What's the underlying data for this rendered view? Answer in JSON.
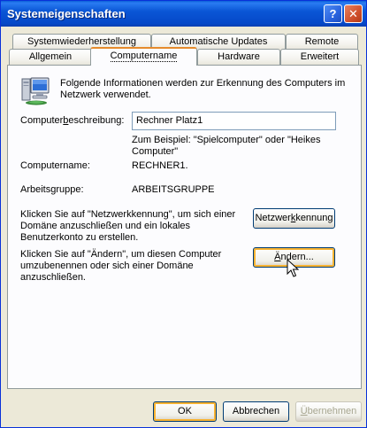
{
  "window": {
    "title": "Systemeigenschaften",
    "help_glyph": "?",
    "close_glyph": "✕"
  },
  "tabs": {
    "row_back": [
      "Systemwiederherstellung",
      "Automatische Updates",
      "Remote"
    ],
    "row_front": [
      "Allgemein",
      "Computername",
      "Hardware",
      "Erweitert"
    ],
    "active": "Computername"
  },
  "panel": {
    "intro_text": "Folgende Informationen werden zur Erkennung des Computers im Netzwerk verwendet.",
    "description": {
      "label_pre": "Computer",
      "label_underlined": "b",
      "label_post": "eschreibung:",
      "value": "Rechner Platz1",
      "hint": "Zum Beispiel: \"Spielcomputer\" oder \"Heikes Computer\""
    },
    "full_name": {
      "label": "Computername:",
      "value": "RECHNER1."
    },
    "workgroup": {
      "label": "Arbeitsgruppe:",
      "value": "ARBEITSGRUPPE"
    },
    "network_id": {
      "text": "Klicken Sie auf \"Netzwerkkennung\", um sich einer Domäne anzuschließen und ein lokales Benutzerkonto zu erstellen.",
      "button_pre": "Netzwer",
      "button_underlined": "k",
      "button_post": "kennung"
    },
    "change": {
      "text": "Klicken Sie auf \"Ändern\", um diesen Computer umzubenennen oder sich einer Domäne anzuschließen.",
      "button_underlined": "Ä",
      "button_post": "ndern..."
    }
  },
  "footer": {
    "ok": "OK",
    "cancel": "Abbrechen",
    "apply_underlined": "Ü",
    "apply_post": "bernehmen"
  },
  "colors": {
    "titlebar": "#0a56d6",
    "dialog_bg": "#ece9d8",
    "panel_bg": "#fcfcfe",
    "active_tab_accent": "#e68b2c"
  },
  "icons": {
    "computer": "computer-network-icon",
    "cursor": "mouse-pointer-icon"
  }
}
